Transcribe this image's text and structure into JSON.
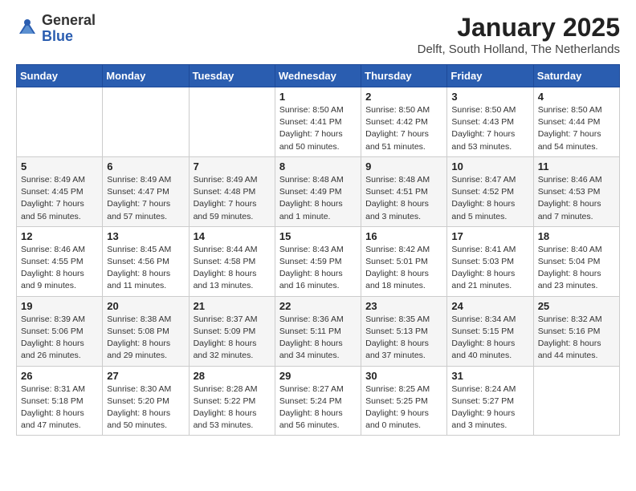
{
  "logo": {
    "general": "General",
    "blue": "Blue"
  },
  "title": "January 2025",
  "subtitle": "Delft, South Holland, The Netherlands",
  "weekdays": [
    "Sunday",
    "Monday",
    "Tuesday",
    "Wednesday",
    "Thursday",
    "Friday",
    "Saturday"
  ],
  "weeks": [
    [
      {
        "day": "",
        "info": ""
      },
      {
        "day": "",
        "info": ""
      },
      {
        "day": "",
        "info": ""
      },
      {
        "day": "1",
        "info": "Sunrise: 8:50 AM\nSunset: 4:41 PM\nDaylight: 7 hours\nand 50 minutes."
      },
      {
        "day": "2",
        "info": "Sunrise: 8:50 AM\nSunset: 4:42 PM\nDaylight: 7 hours\nand 51 minutes."
      },
      {
        "day": "3",
        "info": "Sunrise: 8:50 AM\nSunset: 4:43 PM\nDaylight: 7 hours\nand 53 minutes."
      },
      {
        "day": "4",
        "info": "Sunrise: 8:50 AM\nSunset: 4:44 PM\nDaylight: 7 hours\nand 54 minutes."
      }
    ],
    [
      {
        "day": "5",
        "info": "Sunrise: 8:49 AM\nSunset: 4:45 PM\nDaylight: 7 hours\nand 56 minutes."
      },
      {
        "day": "6",
        "info": "Sunrise: 8:49 AM\nSunset: 4:47 PM\nDaylight: 7 hours\nand 57 minutes."
      },
      {
        "day": "7",
        "info": "Sunrise: 8:49 AM\nSunset: 4:48 PM\nDaylight: 7 hours\nand 59 minutes."
      },
      {
        "day": "8",
        "info": "Sunrise: 8:48 AM\nSunset: 4:49 PM\nDaylight: 8 hours\nand 1 minute."
      },
      {
        "day": "9",
        "info": "Sunrise: 8:48 AM\nSunset: 4:51 PM\nDaylight: 8 hours\nand 3 minutes."
      },
      {
        "day": "10",
        "info": "Sunrise: 8:47 AM\nSunset: 4:52 PM\nDaylight: 8 hours\nand 5 minutes."
      },
      {
        "day": "11",
        "info": "Sunrise: 8:46 AM\nSunset: 4:53 PM\nDaylight: 8 hours\nand 7 minutes."
      }
    ],
    [
      {
        "day": "12",
        "info": "Sunrise: 8:46 AM\nSunset: 4:55 PM\nDaylight: 8 hours\nand 9 minutes."
      },
      {
        "day": "13",
        "info": "Sunrise: 8:45 AM\nSunset: 4:56 PM\nDaylight: 8 hours\nand 11 minutes."
      },
      {
        "day": "14",
        "info": "Sunrise: 8:44 AM\nSunset: 4:58 PM\nDaylight: 8 hours\nand 13 minutes."
      },
      {
        "day": "15",
        "info": "Sunrise: 8:43 AM\nSunset: 4:59 PM\nDaylight: 8 hours\nand 16 minutes."
      },
      {
        "day": "16",
        "info": "Sunrise: 8:42 AM\nSunset: 5:01 PM\nDaylight: 8 hours\nand 18 minutes."
      },
      {
        "day": "17",
        "info": "Sunrise: 8:41 AM\nSunset: 5:03 PM\nDaylight: 8 hours\nand 21 minutes."
      },
      {
        "day": "18",
        "info": "Sunrise: 8:40 AM\nSunset: 5:04 PM\nDaylight: 8 hours\nand 23 minutes."
      }
    ],
    [
      {
        "day": "19",
        "info": "Sunrise: 8:39 AM\nSunset: 5:06 PM\nDaylight: 8 hours\nand 26 minutes."
      },
      {
        "day": "20",
        "info": "Sunrise: 8:38 AM\nSunset: 5:08 PM\nDaylight: 8 hours\nand 29 minutes."
      },
      {
        "day": "21",
        "info": "Sunrise: 8:37 AM\nSunset: 5:09 PM\nDaylight: 8 hours\nand 32 minutes."
      },
      {
        "day": "22",
        "info": "Sunrise: 8:36 AM\nSunset: 5:11 PM\nDaylight: 8 hours\nand 34 minutes."
      },
      {
        "day": "23",
        "info": "Sunrise: 8:35 AM\nSunset: 5:13 PM\nDaylight: 8 hours\nand 37 minutes."
      },
      {
        "day": "24",
        "info": "Sunrise: 8:34 AM\nSunset: 5:15 PM\nDaylight: 8 hours\nand 40 minutes."
      },
      {
        "day": "25",
        "info": "Sunrise: 8:32 AM\nSunset: 5:16 PM\nDaylight: 8 hours\nand 44 minutes."
      }
    ],
    [
      {
        "day": "26",
        "info": "Sunrise: 8:31 AM\nSunset: 5:18 PM\nDaylight: 8 hours\nand 47 minutes."
      },
      {
        "day": "27",
        "info": "Sunrise: 8:30 AM\nSunset: 5:20 PM\nDaylight: 8 hours\nand 50 minutes."
      },
      {
        "day": "28",
        "info": "Sunrise: 8:28 AM\nSunset: 5:22 PM\nDaylight: 8 hours\nand 53 minutes."
      },
      {
        "day": "29",
        "info": "Sunrise: 8:27 AM\nSunset: 5:24 PM\nDaylight: 8 hours\nand 56 minutes."
      },
      {
        "day": "30",
        "info": "Sunrise: 8:25 AM\nSunset: 5:25 PM\nDaylight: 9 hours\nand 0 minutes."
      },
      {
        "day": "31",
        "info": "Sunrise: 8:24 AM\nSunset: 5:27 PM\nDaylight: 9 hours\nand 3 minutes."
      },
      {
        "day": "",
        "info": ""
      }
    ]
  ]
}
